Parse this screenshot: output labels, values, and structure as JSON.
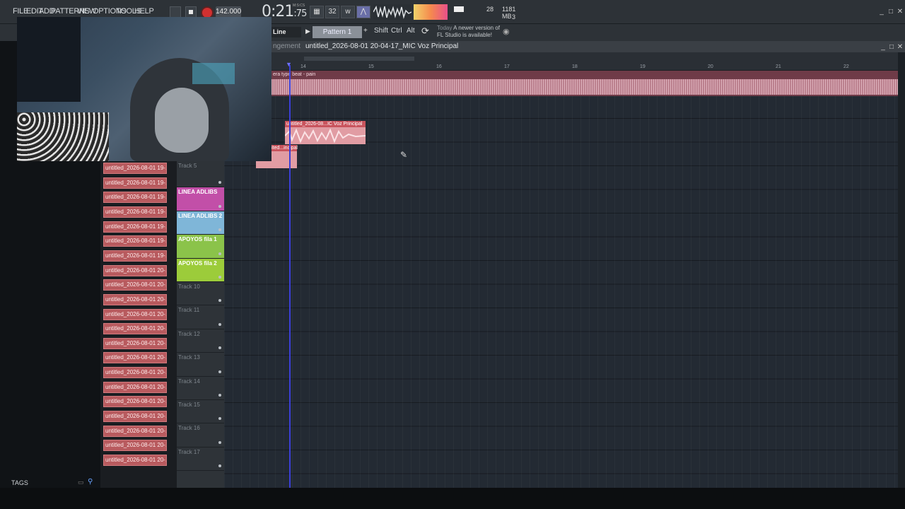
{
  "menu": {
    "file": "FILE",
    "edit": "EDIT",
    "add": "ADD",
    "patterns": "PATTERNS",
    "view": "VIEW",
    "options": "OPTIONS",
    "tools": "TOOLS",
    "help": "HELP"
  },
  "transport": {
    "tempo": "142.000",
    "time_main": "0:21",
    "time_sub": "75",
    "time_unit": "M:S:CS"
  },
  "monitor": {
    "cpu_value": "28",
    "memory": "1181 MB",
    "polyphony": "3"
  },
  "toolbar2": {
    "snap": "Line",
    "pattern": "Pattern 1",
    "shift": "Shift",
    "ctrl": "Ctrl",
    "alt": "Alt",
    "news_when": "Today",
    "news_text": "A newer version of FL Studio is available!"
  },
  "playlist": {
    "title_prefix": "ngement",
    "title": "untitled_2026-08-01 20-04-17_MIC Voz Principal",
    "bars": [
      "14",
      "15",
      "16",
      "17",
      "18",
      "19",
      "20",
      "21",
      "22"
    ],
    "top_clip_label": "era type beat - pain",
    "clip2_label": "untitled_2026-08...IC Voz Principal",
    "clip3_label": "ited...incipal"
  },
  "clips": [
    "untitled_2026-08-01 19-...",
    "untitled_2026-08-01 19-...",
    "untitled_2026-08-01 19-...",
    "untitled_2026-08-01 19-...",
    "untitled_2026-08-01 19-...",
    "untitled_2026-08-01 19-...",
    "untitled_2026-08-01 19-...",
    "untitled_2026-08-01 20-...",
    "untitled_2026-08-01 20-...",
    "untitled_2026-08-01 20-...",
    "untitled_2026-08-01 20-...",
    "untitled_2026-08-01 20-...",
    "untitled_2026-08-01 20-...",
    "untitled_2026-08-01 20-...",
    "untitled_2026-08-01 20-...",
    "untitled_2026-08-01 20-...",
    "untitled_2026-08-01 20-...",
    "untitled_2026-08-01 20-...",
    "untitled_2026-08-01 20-...",
    "untitled_2026-08-01 20-...",
    "untitled_2026-08-01 20-..."
  ],
  "tracks": [
    {
      "name": "Track 5",
      "color": ""
    },
    {
      "name": "LINEA ADLIBS",
      "color": "#c24fa8"
    },
    {
      "name": "LINEA ADLIBS 2",
      "color": "#7fb6d8"
    },
    {
      "name": "APOYOS fila 1",
      "color": "#8bc34a"
    },
    {
      "name": "APOYOS fila 2",
      "color": "#9ccc3a"
    },
    {
      "name": "Track 10",
      "color": ""
    },
    {
      "name": "Track 11",
      "color": ""
    },
    {
      "name": "Track 12",
      "color": ""
    },
    {
      "name": "Track 13",
      "color": ""
    },
    {
      "name": "Track 14",
      "color": ""
    },
    {
      "name": "Track 15",
      "color": ""
    },
    {
      "name": "Track 16",
      "color": ""
    },
    {
      "name": "Track 17",
      "color": ""
    }
  ],
  "browser": {
    "tags": "TAGS"
  }
}
